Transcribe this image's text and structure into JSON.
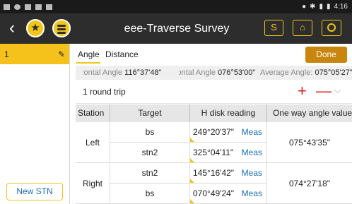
{
  "status_bar": {
    "time": "4:16"
  },
  "app_bar": {
    "title": "eee-Traverse Survey",
    "s_label": "S"
  },
  "sidebar": {
    "stations": [
      {
        "label": "1"
      }
    ],
    "new_station_label": "New STN"
  },
  "tabs": [
    {
      "label": "Angle",
      "active": true
    },
    {
      "label": "Distance",
      "active": false
    }
  ],
  "done_label": "Done",
  "summary": {
    "hz_label": "Horizontal Angle",
    "hz_value": "116°37'48\"",
    "vz_label": "Horizontal Angle",
    "vz_value": "076°53'00\"",
    "avg_label": "Average Angle:",
    "avg_value": "075°05'27\""
  },
  "round": {
    "label": "1 round trip"
  },
  "table": {
    "headers": {
      "station": "Station",
      "target": "Target",
      "hdisk": "H disk reading",
      "oneway": "One way angle value"
    },
    "meas_label": "Meas",
    "faces": [
      {
        "face": "Left",
        "one_way": "075°43'35\"",
        "rows": [
          {
            "target": "bs",
            "reading": "249°20'37\""
          },
          {
            "target": "stn2",
            "reading": "325°04'11\""
          }
        ]
      },
      {
        "face": "Right",
        "one_way": "074°27'18\"",
        "rows": [
          {
            "target": "stn2",
            "reading": "145°16'42\""
          },
          {
            "target": "bs",
            "reading": "070°49'24\""
          }
        ]
      }
    ]
  },
  "colors": {
    "accent": "#f2c619",
    "done_button": "#c8860f",
    "link_blue": "#1a6fb8",
    "delete_red": "#e02020",
    "appbar": "#2d2d2d"
  }
}
